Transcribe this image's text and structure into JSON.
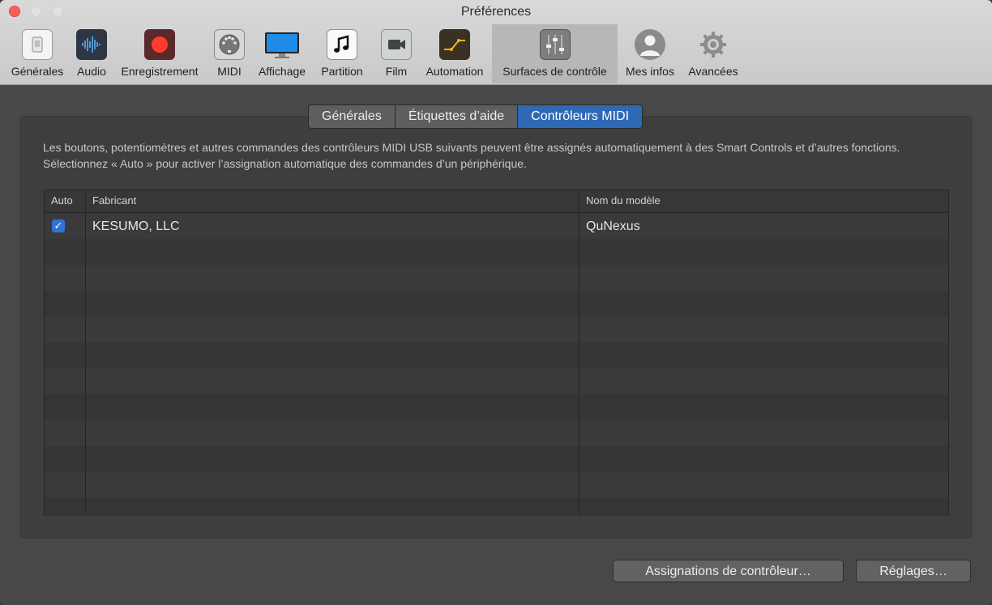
{
  "window": {
    "title": "Préférences"
  },
  "toolbar": {
    "items": [
      {
        "label": "Générales",
        "icon": "switch-icon"
      },
      {
        "label": "Audio",
        "icon": "waveform-icon"
      },
      {
        "label": "Enregistrement",
        "icon": "record-icon"
      },
      {
        "label": "MIDI",
        "icon": "midi-connector-icon"
      },
      {
        "label": "Affichage",
        "icon": "display-icon"
      },
      {
        "label": "Partition",
        "icon": "music-note-icon"
      },
      {
        "label": "Film",
        "icon": "video-camera-icon"
      },
      {
        "label": "Automation",
        "icon": "automation-curve-icon"
      },
      {
        "label": "Surfaces de contrôle",
        "icon": "faders-icon",
        "active": true
      },
      {
        "label": "Mes infos",
        "icon": "user-silhouette-icon"
      },
      {
        "label": "Avancées",
        "icon": "gear-icon"
      }
    ]
  },
  "tabs": [
    {
      "label": "Générales"
    },
    {
      "label": "Étiquettes d’aide"
    },
    {
      "label": "Contrôleurs MIDI",
      "selected": true
    }
  ],
  "description": "Les boutons, potentiomètres et autres commandes des contrôleurs MIDI USB suivants peuvent être assignés automatiquement à des Smart Controls et d’autres fonctions. Sélectionnez « Auto » pour activer l’assignation automatique des commandes d’un périphérique.",
  "table": {
    "columns": [
      "Auto",
      "Fabricant",
      "Nom du modèle"
    ],
    "rows": [
      {
        "auto": true,
        "fabricant": "KESUMO, LLC",
        "modele": "QuNexus"
      }
    ]
  },
  "buttons": {
    "assignations": "Assignations de contrôleur…",
    "reglages": "Réglages…"
  },
  "colors": {
    "accent": "#2e69b5",
    "close": "#fb5f57"
  }
}
